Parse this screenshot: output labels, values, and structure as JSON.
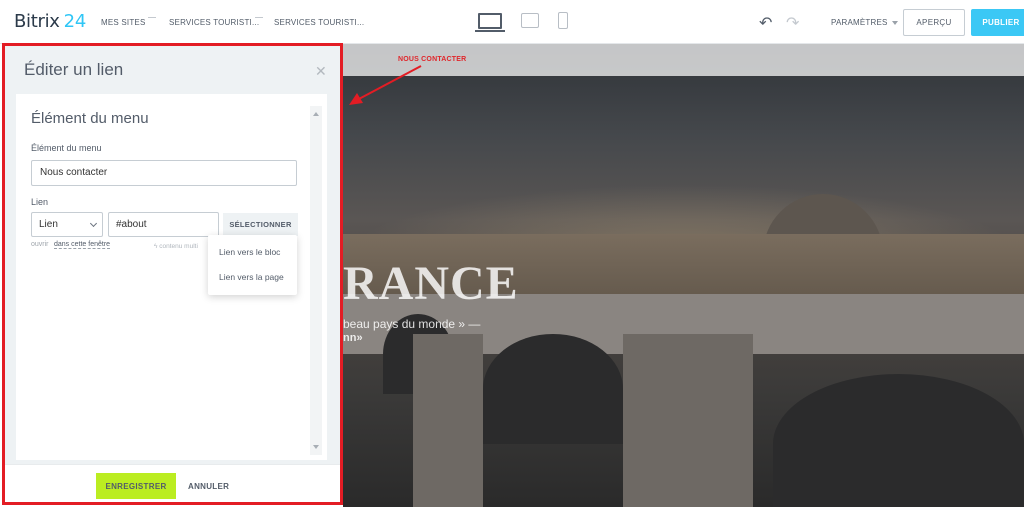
{
  "header": {
    "logo_name": "Bitrix",
    "logo_number": "24",
    "breadcrumbs": [
      "MES SITES",
      "SERVICES TOURISTI...",
      "SERVICES TOURISTI..."
    ],
    "settings_label": "PARAMÈTRES",
    "preview_label": "APERÇU",
    "publish_label": "PUBLIER"
  },
  "annotation": {
    "label": "NOUS CONTACTER",
    "highlight_color": "#e31c24"
  },
  "panel": {
    "title": "Éditer un lien",
    "section_title": "Élément du menu",
    "item_label": "Élément du menu",
    "item_value": "Nous contacter",
    "link_label": "Lien",
    "link_type": "Lien",
    "link_value": "#about",
    "select_button": "SÉLECTIONNER",
    "open_label": "ouvrir",
    "open_target": "dans cette fenêtre",
    "content_hint": "contenu multi",
    "dropdown_items": [
      "Lien vers le bloc",
      "Lien vers la page"
    ],
    "save_label": "ENREGISTRER",
    "cancel_label": "ANNULER"
  },
  "hero": {
    "title": "RANCE",
    "subtitle": "beau pays du monde » —",
    "author": "nn»"
  },
  "colors": {
    "accent": "#3bc8f5",
    "save": "#bbed21"
  }
}
